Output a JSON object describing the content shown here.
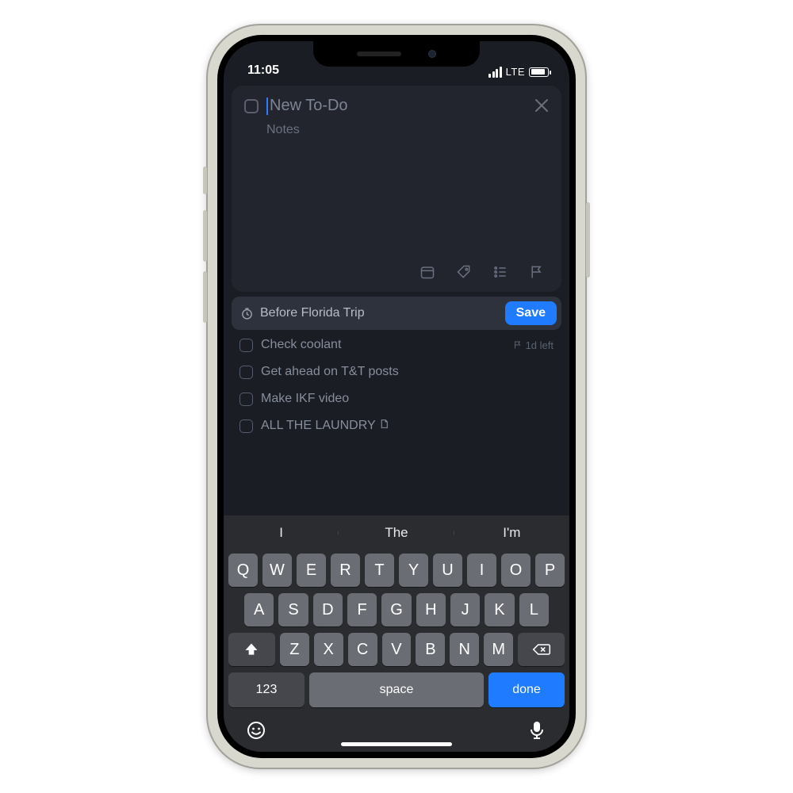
{
  "status": {
    "time": "11:05",
    "network": "LTE"
  },
  "newTodo": {
    "titlePlaceholder": "New To-Do",
    "notesPlaceholder": "Notes"
  },
  "listBar": {
    "label": "Before Florida Trip",
    "saveLabel": "Save"
  },
  "todos": [
    {
      "text": "Check coolant",
      "meta": "1d left",
      "flag": true,
      "hasNote": false
    },
    {
      "text": "Get ahead on T&T posts",
      "meta": "",
      "flag": false,
      "hasNote": false
    },
    {
      "text": "Make IKF video",
      "meta": "",
      "flag": false,
      "hasNote": false
    },
    {
      "text": "ALL THE LAUNDRY",
      "meta": "",
      "flag": false,
      "hasNote": true
    }
  ],
  "keyboard": {
    "suggestions": [
      "I",
      "The",
      "I'm"
    ],
    "row1": [
      "Q",
      "W",
      "E",
      "R",
      "T",
      "Y",
      "U",
      "I",
      "O",
      "P"
    ],
    "row2": [
      "A",
      "S",
      "D",
      "F",
      "G",
      "H",
      "J",
      "K",
      "L"
    ],
    "row3": [
      "Z",
      "X",
      "C",
      "V",
      "B",
      "N",
      "M"
    ],
    "numsLabel": "123",
    "spaceLabel": "space",
    "doneLabel": "done"
  }
}
